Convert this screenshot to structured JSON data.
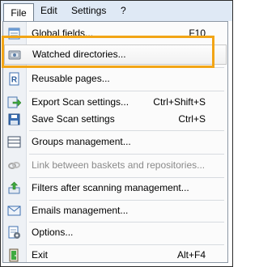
{
  "menubar": {
    "items": [
      {
        "label": "File"
      },
      {
        "label": "Edit"
      },
      {
        "label": "Settings"
      },
      {
        "label": "?"
      }
    ]
  },
  "menu": {
    "items": [
      {
        "label": "Global fields...",
        "shortcut": "F10",
        "icon": "table-form-icon"
      },
      {
        "label": "Watched directories...",
        "shortcut": "",
        "icon": "watched-folder-icon"
      },
      {
        "label": "Reusable pages...",
        "shortcut": "",
        "icon": "reusable-page-icon"
      },
      {
        "label": "Export Scan settings...",
        "shortcut": "Ctrl+Shift+S",
        "icon": "export-icon"
      },
      {
        "label": "Save Scan settings",
        "shortcut": "Ctrl+S",
        "icon": "save-icon"
      },
      {
        "label": "Groups management...",
        "shortcut": "",
        "icon": "groups-list-icon"
      },
      {
        "label": "Link between baskets and repositories...",
        "shortcut": "",
        "icon": "link-icon"
      },
      {
        "label": "Filters after scanning management...",
        "shortcut": "",
        "icon": "filter-upload-icon"
      },
      {
        "label": "Emails management...",
        "shortcut": "",
        "icon": "email-icon"
      },
      {
        "label": "Options...",
        "shortcut": "",
        "icon": "options-icon"
      },
      {
        "label": "Exit",
        "shortcut": "Alt+F4",
        "icon": "exit-icon"
      }
    ]
  },
  "colors": {
    "menubar_bg": "#dfe9f5",
    "highlight_outline": "#f2a516",
    "disabled_text": "#8a8a8a"
  }
}
